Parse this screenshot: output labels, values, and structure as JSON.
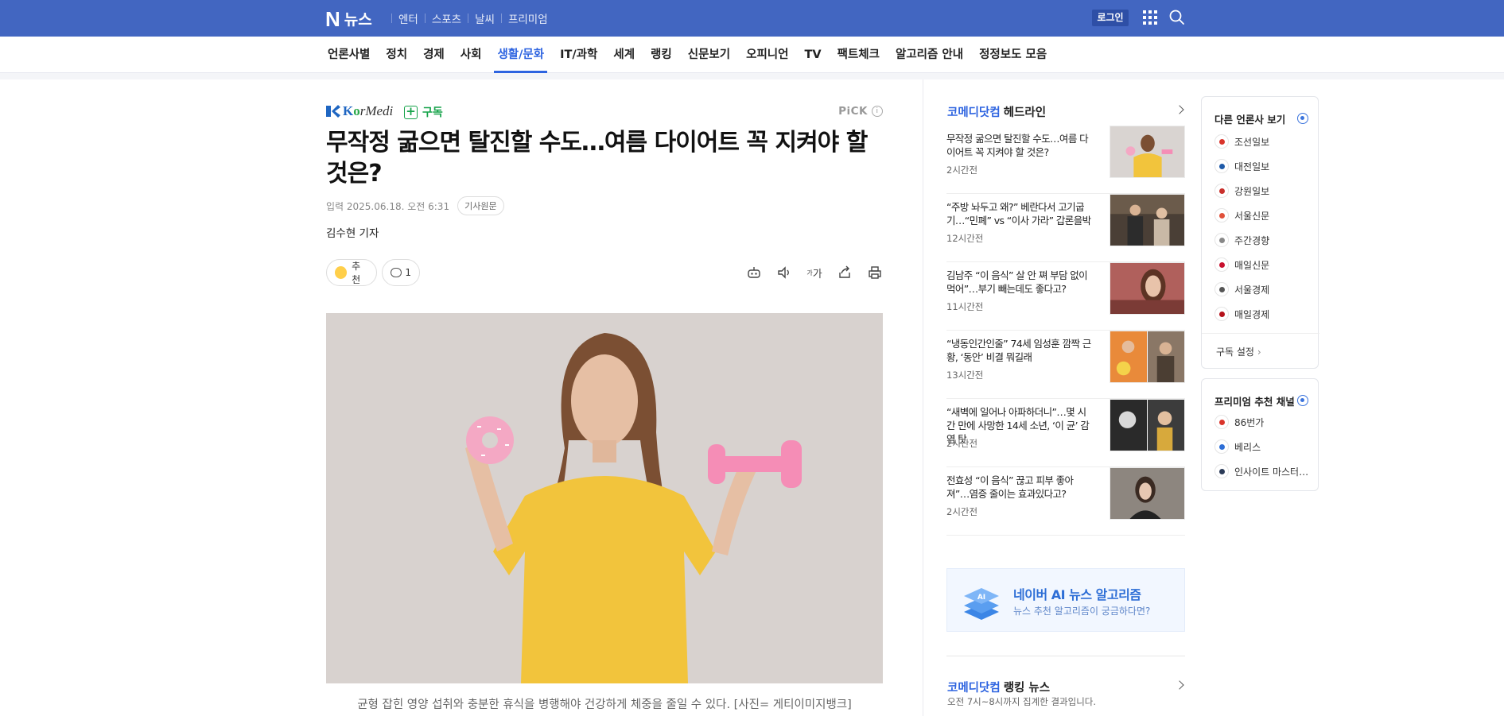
{
  "gnb": {
    "logo_n": "N",
    "logo_text": "뉴스",
    "services": [
      "엔터",
      "스포츠",
      "날씨",
      "프리미엄"
    ],
    "login": "로그인",
    "bg": "#4266c1"
  },
  "lnb": {
    "items": [
      "언론사별",
      "정치",
      "경제",
      "사회",
      "생활/문화",
      "IT/과학",
      "세계",
      "랭킹",
      "신문보기",
      "오피니언",
      "TV",
      "팩트체크",
      "알고리즘 안내",
      "정정보도 모음"
    ],
    "active": "생활/문화"
  },
  "article": {
    "press_name_prefix": "K",
    "press_name_o": "o",
    "press_name_suffix": "rMedi",
    "subscribe": "구독",
    "pick": "PiCK",
    "title": "무작정 굶으면 탈진할 수도…여름 다이어트 꼭 지켜야 할 것은?",
    "date": "입력 2025.06.18. 오전 6:31",
    "original": "기사원문",
    "reporter": "김수현 기자",
    "like_label": "추천",
    "comment_count": "1",
    "font_tool": "가",
    "caption": "균형 잡힌 영양 섭취와 충분한 휴식을 병행해야 건강하게 체중을 줄일 수 있다. [사진= 게티이미지뱅크]"
  },
  "side": {
    "headline_press": "코메디닷컴",
    "headline_label": "헤드라인",
    "news": [
      {
        "title": "무작정 굶으면 탈진할 수도…여름 다이어트 꼭 지켜야 할 것은?",
        "time": "2시간전"
      },
      {
        "title": "“주방 놔두고 왜?” 베란다서 고기굽기…“민폐” vs “이사 가라” 갑론을박",
        "time": "12시간전"
      },
      {
        "title": "김남주 “이 음식” 살 안 쪄 부담 없이 먹어”…부기 빼는데도 좋다고?",
        "time": "11시간전"
      },
      {
        "title": "“냉동인간인줄” 74세 임성훈 깜짝 근황, ‘동안’ 비결 뭐길래",
        "time": "13시간전"
      },
      {
        "title": "“새벽에 일어나 아파하더니”…몇 시간 만에 사망한 14세 소년, ‘이 균’ 감염 탓",
        "time": "2시간전"
      },
      {
        "title": "전효성 “이 음식” 끊고 피부 좋아져”…염증 줄이는 효과있다고?",
        "time": "2시간전"
      }
    ],
    "ai_title": "네이버 AI 뉴스 알고리즘",
    "ai_sub": "뉴스 추천 알고리즘이 궁금하다면?",
    "ai_badge": "AI",
    "ranking_press": "코메디닷컴",
    "ranking_label": "랭킹 뉴스",
    "ranking_sub": "오전 7시~8시까지 집계한 결과입니다."
  },
  "other_press": {
    "title": "다른 언론사 보기",
    "items": [
      {
        "name": "조선일보",
        "color": "#d9342b"
      },
      {
        "name": "대전일보",
        "color": "#1e5aa8"
      },
      {
        "name": "강원일보",
        "color": "#c9302c"
      },
      {
        "name": "서울신문",
        "color": "#e0503a"
      },
      {
        "name": "주간경향",
        "color": "#888888"
      },
      {
        "name": "매일신문",
        "color": "#c8102e"
      },
      {
        "name": "서울경제",
        "color": "#555555"
      },
      {
        "name": "매일경제",
        "color": "#b5121b"
      }
    ],
    "settings": "구독 설정"
  },
  "premium": {
    "title": "프리미엄 추천 채널",
    "items": [
      {
        "name": "86번가",
        "color": "#d9342b"
      },
      {
        "name": "베리스",
        "color": "#2d6ed6"
      },
      {
        "name": "인사이트 마스터…",
        "color": "#2b3a57"
      }
    ]
  }
}
